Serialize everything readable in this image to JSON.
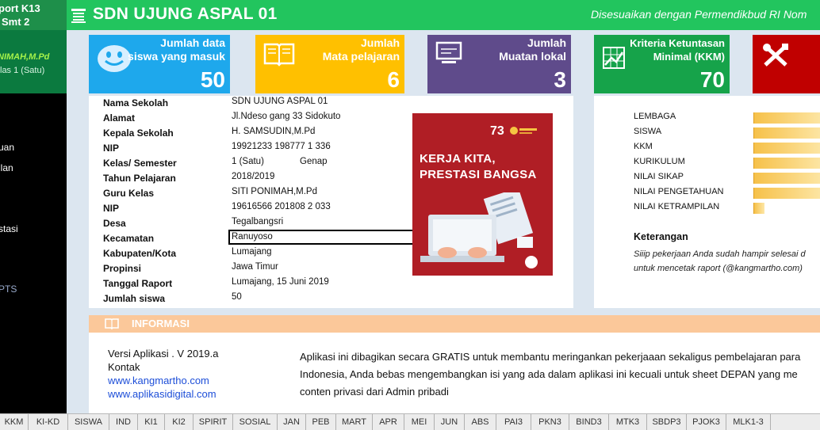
{
  "header": {
    "left_line1": "port K13",
    "left_line2": "Smt 2",
    "title": "SDN UJUNG ASPAL 01",
    "note": "Disesuaikan dengan Permendikbud RI Nom"
  },
  "sidebar": {
    "teacher": "NIMAH,M.Pd",
    "class": "las 1 (Satu)",
    "items": [
      {
        "label": "uan"
      },
      {
        "label": "ilan"
      },
      {
        "label": "stasi"
      },
      {
        "label": "PTS"
      }
    ]
  },
  "cards": [
    {
      "label1": "Jumlah data",
      "label2": "siswa yang masuk",
      "value": "50",
      "icon": "smiley-icon"
    },
    {
      "label1": "Jumlah",
      "label2": "Mata pelajaran",
      "value": "6",
      "icon": "book-icon"
    },
    {
      "label1": "Jumlah",
      "label2": "Muatan lokal",
      "value": "3",
      "icon": "monitor-icon"
    },
    {
      "label1": "Kriteria Ketuntasan",
      "label2": "Minimal (KKM)",
      "value": "70",
      "icon": "chart-icon"
    },
    {
      "icon": "tools-icon"
    }
  ],
  "school": {
    "rows": [
      {
        "key": "Nama Sekolah",
        "value": "SDN UJUNG ASPAL 01"
      },
      {
        "key": "Alamat",
        "value": "Jl.Ndeso gang 33 Sidokuto"
      },
      {
        "key": "Kepala Sekolah",
        "value": "H. SAMSUDIN,M.Pd"
      },
      {
        "key": "NIP",
        "value": "19921233 198777 1 336"
      },
      {
        "key": "Kelas/ Semester",
        "value": "1 (Satu)",
        "value2": "Genap"
      },
      {
        "key": "Tahun Pelajaran",
        "value": "2018/2019"
      },
      {
        "key": "Guru Kelas",
        "value": "SITI PONIMAH,M.Pd"
      },
      {
        "key": "NIP",
        "value": "19616566 201808 2 033"
      },
      {
        "key": "Desa",
        "value": "Tegalbangsri"
      },
      {
        "key": "Kecamatan",
        "value": "Ranuyoso"
      },
      {
        "key": "Kabupaten/Kota",
        "value": "Lumajang"
      },
      {
        "key": "Propinsi",
        "value": "Jawa Timur"
      },
      {
        "key": "Tanggal Raport",
        "value": "Lumajang, 15 Juni 2019"
      },
      {
        "key": "Jumlah siswa",
        "value": "50"
      }
    ]
  },
  "poster": {
    "line1": "KERJA KITA,",
    "line2": "PRESTASI BANGSA",
    "logo_text": "73"
  },
  "progress": {
    "items": [
      {
        "label": "LEMBAGA",
        "fill": 1.0
      },
      {
        "label": "SISWA",
        "fill": 1.0
      },
      {
        "label": "KKM",
        "fill": 1.0
      },
      {
        "label": "KURIKULUM",
        "fill": 1.0
      },
      {
        "label": "NILAI SIKAP",
        "fill": 1.0
      },
      {
        "label": "NILAI PENGETAHUAN",
        "fill": 1.0
      },
      {
        "label": "NILAI KETRAMPILAN",
        "fill": 0.16
      }
    ],
    "keterangan_title": "Keterangan",
    "keterangan_line1": " Siiip pekerjaan Anda sudah hampir selesai d",
    "keterangan_line2": "untuk mencetak raport (@kangmartho.com)"
  },
  "informasi": {
    "title": "INFORMASI",
    "version": "Versi Aplikasi . V 2019.a",
    "contact": "Kontak",
    "link1": "www.kangmartho.com",
    "link2": "www.aplikasidigital.com",
    "desc1": "Aplikasi ini dibagikan secara GRATIS untuk membantu meringankan pekerjaaan sekaligus pembelajaran para",
    "desc2": "Indonesia, Anda bebas mengembangkan isi yang ada dalam aplikasi ini kecuali untuk sheet DEPAN yang me",
    "desc3": "conten privasi dari Admin pribadi"
  },
  "tabs": [
    "KKM",
    "KI-KD",
    "SISWA",
    "IND",
    "KI1",
    "KI2",
    "SPIRIT",
    "SOSIAL",
    "JAN",
    "PEB",
    "MART",
    "APR",
    "MEI",
    "JUN",
    "ABS",
    "PAI3",
    "PKN3",
    "BIND3",
    "MTK3",
    "SBDP3",
    "PJOK3",
    "MLK1-3"
  ],
  "colors": {
    "header_green": "#22c55e",
    "card_blue": "#1ea8ec",
    "card_yellow": "#ffc000",
    "card_purple": "#5f4b8b",
    "card_green": "#16a34a",
    "card_red": "#c00000",
    "informasi_header": "#fbc89a",
    "poster_red": "#b01e25"
  }
}
